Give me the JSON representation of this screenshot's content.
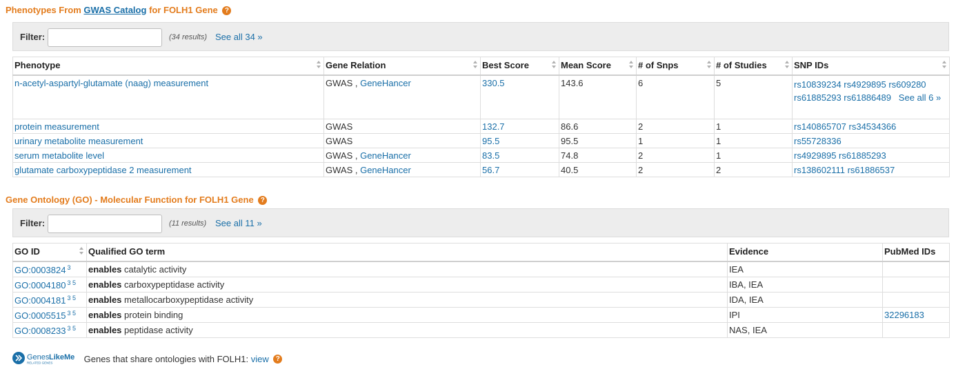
{
  "phenotypes": {
    "title_pre": "Phenotypes From",
    "title_link": "GWAS Catalog",
    "title_post": "for FOLH1 Gene",
    "help_glyph": "?",
    "filter_label": "Filter:",
    "filter_value": "",
    "results": "(34 results)",
    "see_all": "See all 34 »",
    "headers": [
      "Phenotype",
      "Gene Relation",
      "Best Score",
      "Mean Score",
      "# of Snps",
      "# of Studies",
      "SNP IDs"
    ],
    "rows": [
      {
        "phenotype": "n-acetyl-aspartyl-glutamate (naag) measurement",
        "rel_text": "GWAS ,",
        "rel_link": "GeneHancer",
        "best": "330.5",
        "mean": "143.6",
        "snps": "6",
        "studies": "5",
        "snp_line1": "rs10839234 rs4929895 rs609280",
        "snp_line2": "rs61885293 rs61886489",
        "snp_more": "See all 6 »"
      },
      {
        "phenotype": "protein measurement",
        "rel_text": "GWAS",
        "rel_link": "",
        "best": "132.7",
        "mean": "86.6",
        "snps": "2",
        "studies": "1",
        "snp_line1": "rs140865707 rs34534366"
      },
      {
        "phenotype": "urinary metabolite measurement",
        "rel_text": "GWAS",
        "rel_link": "",
        "best": "95.5",
        "mean": "95.5",
        "snps": "1",
        "studies": "1",
        "snp_line1": "rs55728336"
      },
      {
        "phenotype": "serum metabolite level",
        "rel_text": "GWAS ,",
        "rel_link": "GeneHancer",
        "best": "83.5",
        "mean": "74.8",
        "snps": "2",
        "studies": "1",
        "snp_line1": "rs4929895 rs61885293"
      },
      {
        "phenotype": "glutamate carboxypeptidase 2 measurement",
        "rel_text": "GWAS ,",
        "rel_link": "GeneHancer",
        "best": "56.7",
        "mean": "40.5",
        "snps": "2",
        "studies": "2",
        "snp_line1": "rs138602111 rs61886537"
      }
    ]
  },
  "go": {
    "title": "Gene Ontology (GO) - Molecular Function for FOLH1 Gene",
    "help_glyph": "?",
    "filter_label": "Filter:",
    "filter_value": "",
    "results": "(11 results)",
    "see_all": "See all 11 »",
    "headers": [
      "GO ID",
      "Qualified GO term",
      "Evidence",
      "PubMed IDs"
    ],
    "rows": [
      {
        "id": "GO:0003824",
        "sup": "3",
        "qualifier": "enables",
        "term": "catalytic activity",
        "evidence": "IEA",
        "pubmed": ""
      },
      {
        "id": "GO:0004180",
        "sup": "3 5",
        "qualifier": "enables",
        "term": "carboxypeptidase activity",
        "evidence": "IBA, IEA",
        "pubmed": ""
      },
      {
        "id": "GO:0004181",
        "sup": "3 5",
        "qualifier": "enables",
        "term": "metallocarboxypeptidase activity",
        "evidence": "IDA, IEA",
        "pubmed": ""
      },
      {
        "id": "GO:0005515",
        "sup": "3 5",
        "qualifier": "enables",
        "term": "protein binding",
        "evidence": "IPI",
        "pubmed": "32296183"
      },
      {
        "id": "GO:0008233",
        "sup": "3 5",
        "qualifier": "enables",
        "term": "peptidase activity",
        "evidence": "NAS, IEA",
        "pubmed": ""
      }
    ]
  },
  "geneslikeme": {
    "logo_text1": "Genes",
    "logo_text2": "LikeMe",
    "logo_sub": "RELATED GENES",
    "text": "Genes that share ontologies with FOLH1:",
    "link": "view",
    "help_glyph": "?"
  },
  "colors": {
    "section_title": "#e37c1d",
    "link": "#1a6fa8",
    "filter_bg": "#ededed"
  }
}
